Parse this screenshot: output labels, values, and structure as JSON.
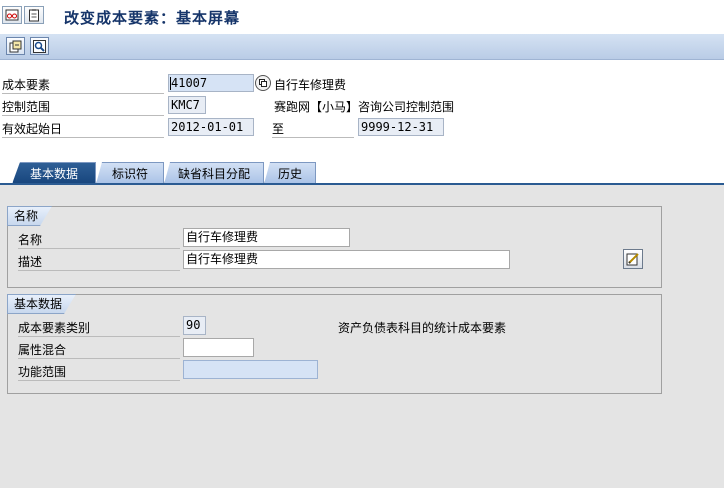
{
  "title": "改变成本要素：基本屏幕",
  "title_icons": [
    "glasses-icon",
    "clipboard-icon"
  ],
  "toolbar": {
    "buttons": [
      "display-change-icon",
      "find-icon"
    ]
  },
  "header": {
    "cost_element_label": "成本要素",
    "cost_element_value": "41007",
    "cost_element_desc": "自行车修理费",
    "controlling_area_label": "控制范围",
    "controlling_area_value": "KMC7",
    "controlling_area_desc": "赛跑网【小马】咨询公司控制范围",
    "valid_from_label": "有效起始日",
    "valid_from_value": "2012-01-01",
    "to_label": "至",
    "valid_to_value": "9999-12-31"
  },
  "tabs": [
    {
      "label": "基本数据",
      "active": true
    },
    {
      "label": "标识符",
      "active": false
    },
    {
      "label": "缺省科目分配",
      "active": false
    },
    {
      "label": "历史",
      "active": false
    }
  ],
  "names_group": {
    "title": "名称",
    "name_label": "名称",
    "name_value": "自行车修理费",
    "desc_label": "描述",
    "desc_value": "自行车修理费"
  },
  "basic_group": {
    "title": "基本数据",
    "category_label": "成本要素类别",
    "category_value": "90",
    "category_desc": "资产负债表科目的统计成本要素",
    "attr_label": "属性混合",
    "attr_value": "",
    "func_area_label": "功能范围",
    "func_area_value": ""
  },
  "colors": {
    "title_text": "#16356a",
    "tab_active": "#17457d",
    "panel_bg": "#e4e4e4"
  }
}
